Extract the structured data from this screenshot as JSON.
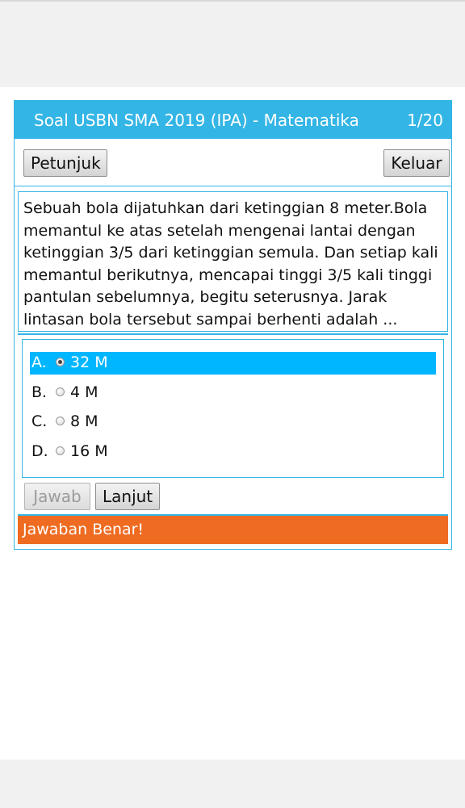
{
  "header": {
    "title": "Soal USBN SMA 2019 (IPA) - Matematika",
    "counter": "1/20"
  },
  "toolbar": {
    "instructions_label": "Petunjuk",
    "exit_label": "Keluar"
  },
  "question": {
    "text": "Sebuah bola dijatuhkan dari ketinggian 8 meter.Bola memantul ke atas setelah mengenai lantai dengan ketinggian 3/5 dari ketinggian semula. Dan setiap kali memantul berikutnya, mencapai tinggi 3/5 kali tinggi pantulan sebelumnya, begitu seterusnya. Jarak lintasan bola tersebut sampai berhenti adalah ..."
  },
  "options": [
    {
      "letter": "A.",
      "text": "32 M",
      "selected": true
    },
    {
      "letter": "B.",
      "text": "4 M",
      "selected": false
    },
    {
      "letter": "C.",
      "text": "8 M",
      "selected": false
    },
    {
      "letter": "D.",
      "text": "16 M",
      "selected": false
    }
  ],
  "actions": {
    "answer_label": "Jawab",
    "next_label": "Lanjut"
  },
  "feedback": {
    "text": "Jawaban Benar!"
  },
  "colors": {
    "accent": "#33b5e5",
    "selected_option": "#00b6ff",
    "feedback_bg": "#ee6b21"
  }
}
